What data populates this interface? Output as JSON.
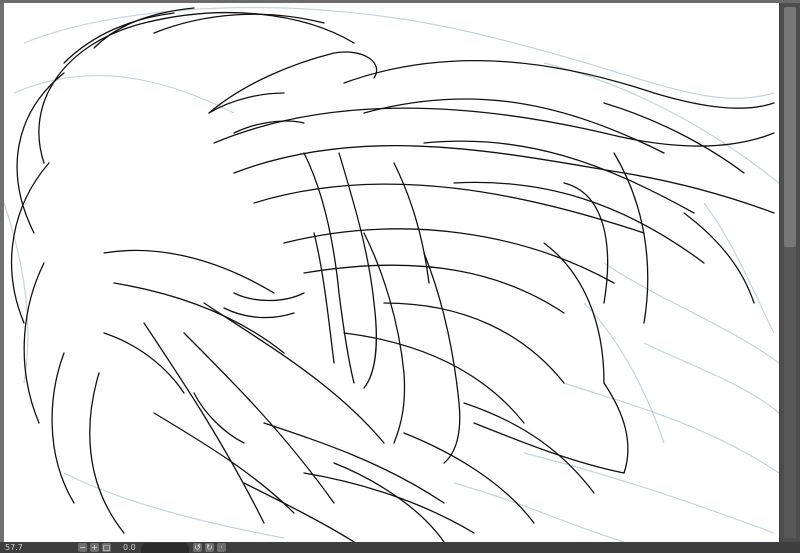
{
  "status_bar": {
    "zoom": "57.7",
    "angle": "0.0",
    "icons": [
      "zoom-out-icon",
      "zoom-in-icon",
      "fit-view-icon",
      "rotate-left-icon",
      "rotate-right-icon",
      "reset-rotation-icon"
    ]
  },
  "colors": {
    "canvas": "#ffffff",
    "ink_lines": "#111111",
    "sketch_lines": "#c9d3da",
    "app_chrome": "#5a5a5a",
    "status_bar": "#3e3e3e"
  }
}
